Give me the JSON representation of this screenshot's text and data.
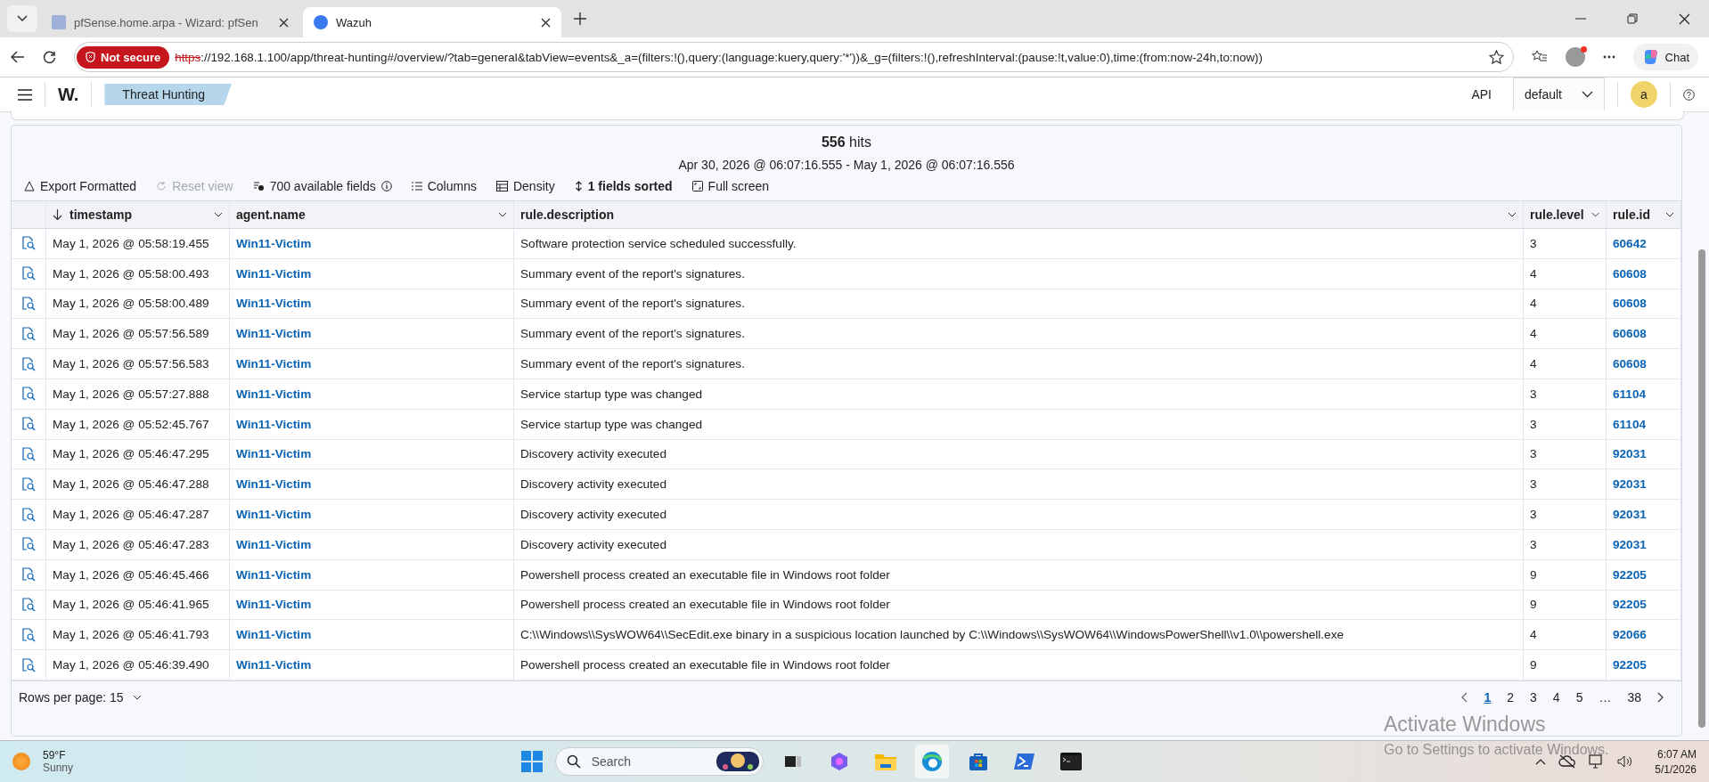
{
  "browser": {
    "tabs": [
      {
        "title": "pfSense.home.arpa - Wizard: pfSen",
        "selected": false,
        "kind": "pfsense"
      },
      {
        "title": "Wazuh",
        "selected": true,
        "kind": "wazuh"
      }
    ],
    "security_badge": "Not secure",
    "url_scheme": "https",
    "url_rest": "://192.168.1.100/app/threat-hunting#/overview/?tab=general&tabView=events&_a=(filters:!(),query:(language:kuery,query:'*'))&_g=(filters:!(),refreshInterval:(pause:!t,value:0),time:(from:now-24h,to:now))",
    "chat_button": "Chat"
  },
  "app_header": {
    "logo": "W.",
    "breadcrumb": "Threat Hunting",
    "api_label": "API",
    "api_select": "default",
    "avatar": "a"
  },
  "results": {
    "hits_count": "556",
    "hits_label": "hits",
    "time_range": "Apr 30, 2026 @ 06:07:16.555 - May 1, 2026 @ 06:07:16.556",
    "toolbar": [
      {
        "label": "Export Formatted",
        "kind": "export",
        "disabled": false,
        "bold": false
      },
      {
        "label": "Reset view",
        "kind": "reset",
        "disabled": true,
        "bold": false
      },
      {
        "label": "700 available fields",
        "kind": "fields",
        "disabled": false,
        "bold": false
      },
      {
        "label": "Columns",
        "kind": "columns",
        "disabled": false,
        "bold": false
      },
      {
        "label": "Density",
        "kind": "density",
        "disabled": false,
        "bold": false
      },
      {
        "label": "1 fields sorted",
        "kind": "sort",
        "disabled": false,
        "bold": true
      },
      {
        "label": "Full screen",
        "kind": "fullscreen",
        "disabled": false,
        "bold": false
      }
    ],
    "columns": [
      {
        "label": "timestamp",
        "sorted": true
      },
      {
        "label": "agent.name",
        "sorted": false
      },
      {
        "label": "rule.description",
        "sorted": false
      },
      {
        "label": "rule.level",
        "sorted": false
      },
      {
        "label": "rule.id",
        "sorted": false
      }
    ],
    "rows": [
      [
        "May 1, 2026 @ 05:58:19.455",
        "Win11-Victim",
        "Software protection service scheduled successfully.",
        "3",
        "60642"
      ],
      [
        "May 1, 2026 @ 05:58:00.493",
        "Win11-Victim",
        "Summary event of the report's signatures.",
        "4",
        "60608"
      ],
      [
        "May 1, 2026 @ 05:58:00.489",
        "Win11-Victim",
        "Summary event of the report's signatures.",
        "4",
        "60608"
      ],
      [
        "May 1, 2026 @ 05:57:56.589",
        "Win11-Victim",
        "Summary event of the report's signatures.",
        "4",
        "60608"
      ],
      [
        "May 1, 2026 @ 05:57:56.583",
        "Win11-Victim",
        "Summary event of the report's signatures.",
        "4",
        "60608"
      ],
      [
        "May 1, 2026 @ 05:57:27.888",
        "Win11-Victim",
        "Service startup type was changed",
        "3",
        "61104"
      ],
      [
        "May 1, 2026 @ 05:52:45.767",
        "Win11-Victim",
        "Service startup type was changed",
        "3",
        "61104"
      ],
      [
        "May 1, 2026 @ 05:46:47.295",
        "Win11-Victim",
        "Discovery activity executed",
        "3",
        "92031"
      ],
      [
        "May 1, 2026 @ 05:46:47.288",
        "Win11-Victim",
        "Discovery activity executed",
        "3",
        "92031"
      ],
      [
        "May 1, 2026 @ 05:46:47.287",
        "Win11-Victim",
        "Discovery activity executed",
        "3",
        "92031"
      ],
      [
        "May 1, 2026 @ 05:46:47.283",
        "Win11-Victim",
        "Discovery activity executed",
        "3",
        "92031"
      ],
      [
        "May 1, 2026 @ 05:46:45.466",
        "Win11-Victim",
        "Powershell process created an executable file in Windows root folder",
        "9",
        "92205"
      ],
      [
        "May 1, 2026 @ 05:46:41.965",
        "Win11-Victim",
        "Powershell process created an executable file in Windows root folder",
        "9",
        "92205"
      ],
      [
        "May 1, 2026 @ 05:46:41.793",
        "Win11-Victim",
        "C:\\\\Windows\\\\SysWOW64\\\\SecEdit.exe binary in a suspicious location launched by C:\\\\Windows\\\\SysWOW64\\\\WindowsPowerShell\\\\v1.0\\\\powershell.exe",
        "4",
        "92066"
      ],
      [
        "May 1, 2026 @ 05:46:39.490",
        "Win11-Victim",
        "Powershell process created an executable file in Windows root folder",
        "9",
        "92205"
      ]
    ],
    "rows_per_page": "Rows per page: 15",
    "pages": [
      {
        "label": "1",
        "selected": true
      },
      {
        "label": "2",
        "selected": false
      },
      {
        "label": "3",
        "selected": false
      },
      {
        "label": "4",
        "selected": false
      },
      {
        "label": "5",
        "selected": false
      },
      {
        "label": "…",
        "selected": false
      },
      {
        "label": "38",
        "selected": false
      }
    ]
  },
  "activation_notice": {
    "title": "Activate Windows",
    "subtitle": "Go to Settings to activate Windows."
  },
  "taskbar": {
    "temperature": "59°F",
    "condition": "Sunny",
    "search_placeholder": "Search",
    "time": "6:07 AM",
    "date": "5/1/2026"
  }
}
